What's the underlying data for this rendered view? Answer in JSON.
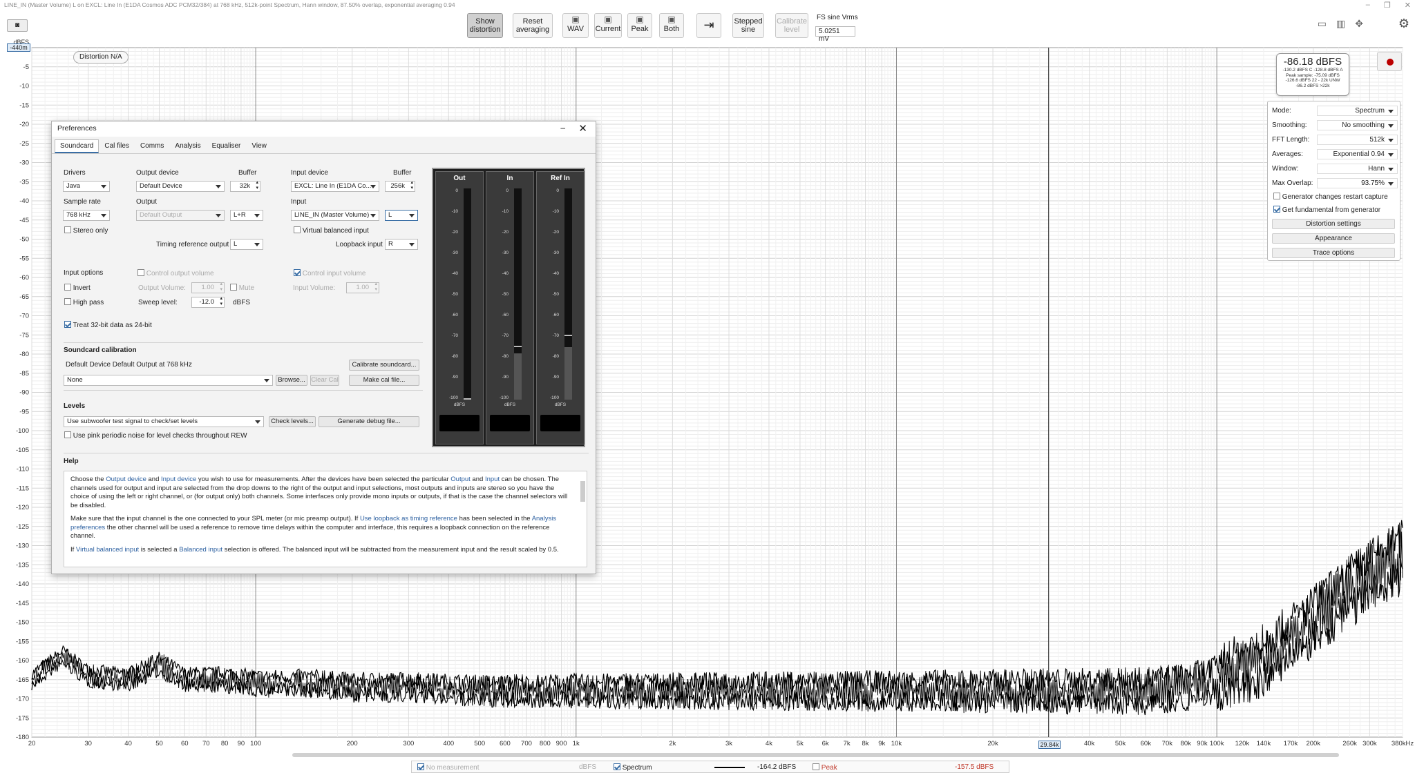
{
  "window_title": "LINE_IN (Master Volume) L on EXCL: Line In (E1DA Cosmos ADC PCM32/384) at 768 kHz, 512k-point Spectrum, Hann window, 87.50% overlap, exponential averaging 0.94",
  "toolbar": {
    "show_distortion": "Show distortion",
    "reset_averaging": "Reset averaging",
    "wav": "WAV",
    "current": "Current",
    "peak": "Peak",
    "both": "Both",
    "stepped_sine": "Stepped sine",
    "calibrate_level": "Calibrate level",
    "fs_sine_label": "FS sine Vrms",
    "fs_sine_value": "5.0251 mV"
  },
  "plot": {
    "distortion_badge": "Distortion N/A",
    "y_unit": "dBFS",
    "y_marker": "-440m",
    "x_marker": "29.84k",
    "y_ticks": [
      "-5",
      "-10",
      "-15",
      "-20",
      "-25",
      "-30",
      "-35",
      "-40",
      "-45",
      "-50",
      "-55",
      "-60",
      "-65",
      "-70",
      "-75",
      "-80",
      "-85",
      "-90",
      "-95",
      "-100",
      "-105",
      "-110",
      "-115",
      "-120",
      "-125",
      "-130",
      "-135",
      "-140",
      "-145",
      "-150",
      "-155",
      "-160",
      "-165",
      "-170",
      "-175",
      "-180"
    ],
    "x_ticks": [
      {
        "f": 20,
        "label": "20"
      },
      {
        "f": 30,
        "label": "30"
      },
      {
        "f": 40,
        "label": "40"
      },
      {
        "f": 50,
        "label": "50"
      },
      {
        "f": 60,
        "label": "60"
      },
      {
        "f": 70,
        "label": "70"
      },
      {
        "f": 80,
        "label": "80"
      },
      {
        "f": 90,
        "label": "90"
      },
      {
        "f": 100,
        "label": "100"
      },
      {
        "f": 200,
        "label": "200"
      },
      {
        "f": 300,
        "label": "300"
      },
      {
        "f": 400,
        "label": "400"
      },
      {
        "f": 500,
        "label": "500"
      },
      {
        "f": 600,
        "label": "600"
      },
      {
        "f": 700,
        "label": "700"
      },
      {
        "f": 800,
        "label": "800"
      },
      {
        "f": 900,
        "label": "900"
      },
      {
        "f": 1000,
        "label": "1k"
      },
      {
        "f": 2000,
        "label": "2k"
      },
      {
        "f": 3000,
        "label": "3k"
      },
      {
        "f": 4000,
        "label": "4k"
      },
      {
        "f": 5000,
        "label": "5k"
      },
      {
        "f": 6000,
        "label": "6k"
      },
      {
        "f": 7000,
        "label": "7k"
      },
      {
        "f": 8000,
        "label": "8k"
      },
      {
        "f": 9000,
        "label": "9k"
      },
      {
        "f": 10000,
        "label": "10k"
      },
      {
        "f": 20000,
        "label": "20k"
      },
      {
        "f": 40000,
        "label": "40k"
      },
      {
        "f": 50000,
        "label": "50k"
      },
      {
        "f": 60000,
        "label": "60k"
      },
      {
        "f": 70000,
        "label": "70k"
      },
      {
        "f": 80000,
        "label": "80k"
      },
      {
        "f": 90000,
        "label": "90k"
      },
      {
        "f": 100000,
        "label": "100k"
      },
      {
        "f": 120000,
        "label": "120k"
      },
      {
        "f": 140000,
        "label": "140k"
      },
      {
        "f": 170000,
        "label": "170k"
      },
      {
        "f": 200000,
        "label": "200k"
      },
      {
        "f": 260000,
        "label": "260k"
      },
      {
        "f": 300000,
        "label": "300k"
      },
      {
        "f": 380000,
        "label": "380kHz"
      }
    ]
  },
  "chart_data": {
    "type": "line",
    "x_scale": "log",
    "xlim": [
      20,
      380000
    ],
    "ylim": [
      -180,
      0
    ],
    "ylabel": "dBFS",
    "series": [
      {
        "name": "Spectrum",
        "x": [
          20,
          25,
          30,
          40,
          50,
          60,
          80,
          100,
          150,
          200,
          300,
          500,
          1000,
          2000,
          5000,
          10000,
          20000,
          40000,
          60000,
          80000,
          100000,
          140000,
          200000,
          260000,
          300000,
          380000
        ],
        "y": [
          -165,
          -159,
          -164,
          -165,
          -161,
          -165,
          -165,
          -166,
          -166,
          -167,
          -167,
          -168,
          -168,
          -168,
          -168,
          -168,
          -168,
          -168,
          -168,
          -167,
          -165,
          -160,
          -150,
          -142,
          -138,
          -133
        ]
      }
    ]
  },
  "level": {
    "main": "-86.18 dBFS",
    "lines": [
      "-130.2 dBFS C  -128.8 dBFS A",
      "Peak sample: -75.09 dBFS",
      "-126.6 dBFS 22 - 22k UNW",
      "-86.2 dBFS >22k"
    ]
  },
  "controls": {
    "rows": [
      {
        "label": "Mode:",
        "value": "Spectrum"
      },
      {
        "label": "Smoothing:",
        "value": "No smoothing"
      },
      {
        "label": "FFT Length:",
        "value": "512k"
      },
      {
        "label": "Averages:",
        "value": "Exponential 0.94"
      },
      {
        "label": "Window:",
        "value": "Hann"
      },
      {
        "label": "Max Overlap:",
        "value": "93.75%"
      }
    ],
    "gen_restart": "Generator changes restart capture",
    "get_fundamental": "Get fundamental from generator",
    "distortion_settings": "Distortion settings",
    "appearance": "Appearance",
    "trace_options": "Trace options"
  },
  "legend": {
    "no_measurement": "No measurement",
    "dbfs": "dBFS",
    "spectrum": "Spectrum",
    "spectrum_value": "-164.2 dBFS",
    "peak": "Peak",
    "peak_value": "-157.5 dBFS"
  },
  "prefs": {
    "title": "Preferences",
    "tabs": [
      "Soundcard",
      "Cal files",
      "Comms",
      "Analysis",
      "Equaliser",
      "View"
    ],
    "drivers_label": "Drivers",
    "drivers_value": "Java",
    "output_device_label": "Output device",
    "output_device_value": "Default Device",
    "buffer_label": "Buffer",
    "out_buffer": "32k",
    "input_device_label": "Input device",
    "input_device_value": "EXCL: Line In (E1DA Co...",
    "in_buffer": "256k",
    "sample_rate_label": "Sample rate",
    "sample_rate_value": "768 kHz",
    "output_label": "Output",
    "output_value": "Default Output",
    "output_channel": "L+R",
    "input_label": "Input",
    "input_value": "LINE_IN (Master Volume)",
    "input_channel": "L",
    "stereo_only": "Stereo only",
    "virtual_balanced": "Virtual balanced input",
    "timing_ref_label": "Timing reference output",
    "timing_ref_value": "L",
    "loopback_label": "Loopback input",
    "loopback_value": "R",
    "input_options": "Input options",
    "control_output_volume": "Control output volume",
    "control_input_volume": "Control input volume",
    "invert": "Invert",
    "output_volume_label": "Output Volume:",
    "output_volume_value": "1.00",
    "mute": "Mute",
    "input_volume_label": "Input Volume:",
    "input_volume_value": "1.00",
    "high_pass": "High pass",
    "sweep_level_label": "Sweep level:",
    "sweep_level_value": "-12.0",
    "sweep_unit": "dBFS",
    "treat_32bit": "Treat 32-bit data as 24-bit",
    "soundcard_cal": "Soundcard calibration",
    "cal_desc": "Default Device Default Output at 768 kHz",
    "calibrate_btn": "Calibrate soundcard...",
    "cal_file_value": "None",
    "browse_btn": "Browse...",
    "clear_cal_btn": "Clear Cal",
    "make_cal_btn": "Make cal file...",
    "levels": "Levels",
    "levels_select": "Use subwoofer test signal to check/set levels",
    "check_levels_btn": "Check levels...",
    "debug_btn": "Generate debug file...",
    "pink_noise": "Use pink periodic noise for level checks throughout REW",
    "help": "Help",
    "meters": [
      {
        "title": "Out",
        "level": -100,
        "peak": -100
      },
      {
        "title": "In",
        "level": -78,
        "peak": -75
      },
      {
        "title": "Ref In",
        "level": -75,
        "peak": -70
      }
    ],
    "meter_ticks": [
      "0",
      "-10",
      "-20",
      "-30",
      "-40",
      "-50",
      "-60",
      "-70",
      "-80",
      "-90",
      "-100"
    ],
    "meter_unit": "dBFS"
  }
}
